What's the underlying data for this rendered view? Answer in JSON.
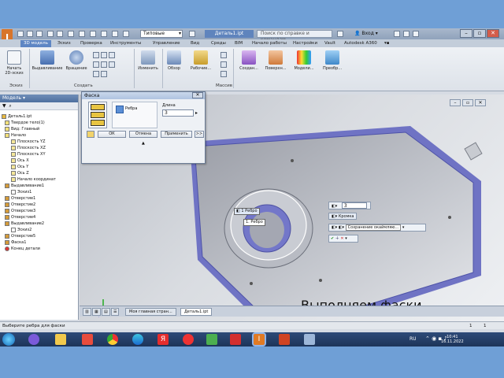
{
  "titlebar": {
    "style_combo": "Типовые",
    "document": "Деталь1.ipt",
    "search_placeholder": "Поиск по справке и командам",
    "user": "Вход"
  },
  "ribbon_tabs": [
    "3D модель",
    "Эскиз",
    "Проверка",
    "Инструменты",
    "Управление",
    "Вид",
    "Среды",
    "BIM",
    "Начало работы",
    "Настройки",
    "Vault",
    "Autodesk A360"
  ],
  "ribbon": {
    "start_sketch": "Начать 2D-эскиз",
    "extrude": "Выдавливание",
    "revolve": "Вращение",
    "modify": "Изменить",
    "explore": "Обзор",
    "work_features": "Рабочие...",
    "create_group": "Создан...",
    "surface": "Поверхн...",
    "model": "Модели...",
    "transform": "Преобр...",
    "panel_sketch": "Эскиз",
    "panel_create": "Создать",
    "panel_mass": "Массив"
  },
  "browser": {
    "header": "Модель ▾",
    "items": [
      "Деталь1.ipt",
      "Твердое тело(1)",
      "Вид: Главный",
      "Начало",
      "Плоскость YZ",
      "Плоскость XZ",
      "Плоскость XY",
      "Ось X",
      "Ось Y",
      "Ось Z",
      "Начало координат",
      "Выдавливание1",
      "Эскиз1",
      "Отверстие1",
      "Отверстие2",
      "Отверстие3",
      "Отверстие4",
      "Выдавливание2",
      "Эскиз2",
      "Отверстие5",
      "Фаска1",
      "Конец детали"
    ]
  },
  "dialog": {
    "title": "Фаска",
    "edge_label": "Ребра",
    "distance_label": "Длина",
    "distance_value": "3",
    "ok": "ОК",
    "cancel": "Отмена",
    "apply": "Применить",
    "expand": ">>"
  },
  "viewport": {
    "caption": "Выполняем фаски",
    "edge_pill": "1 Ребро",
    "edge_tooltip": "1. Ребро",
    "mini_value": "3",
    "mini_mode": "Кромка",
    "mini_option": "Сохранение окаймляю..."
  },
  "doc_tabs": [
    "Моя главная стран...",
    "Деталь1.ipt"
  ],
  "status": "Выберите ребра для фаски",
  "status_right": [
    "1",
    "1"
  ],
  "tray": {
    "lang": "RU",
    "time": "10:41",
    "date": "16.11.2022"
  }
}
